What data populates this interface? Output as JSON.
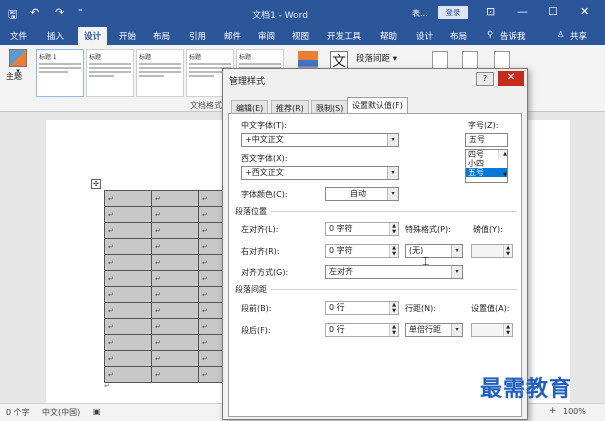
{
  "titlebar": {
    "doc_title": "文档1 - Word",
    "account": "表...",
    "login": "登录",
    "save_glyph": "🖫",
    "undo_glyph": "↶",
    "redo_glyph": "↷",
    "customize_glyph": "⁼",
    "ribbon_display_glyph": "⊡",
    "minimize_glyph": "—",
    "maximize_glyph": "☐",
    "close_glyph": "✕"
  },
  "tabs": [
    "文件",
    "插入",
    "设计",
    "开始",
    "布局",
    "引用",
    "邮件",
    "审阅",
    "视图",
    "开发工具",
    "帮助",
    "设计",
    "布局"
  ],
  "active_tab_index": 2,
  "tell_me": "告诉我",
  "share": "共享",
  "ribbon": {
    "theme_label": "主题",
    "theme_dropdown": "▾",
    "gallery": [
      {
        "title": "标题 1"
      },
      {
        "title": "标题"
      },
      {
        "title": "标题"
      },
      {
        "title": "标题"
      },
      {
        "title": "标题"
      }
    ],
    "group_label": "文档格式",
    "fonts_glyph": "文",
    "paragraph_spacing": "段落间距",
    "paragraph_spacing_arrow": "▾"
  },
  "dialog": {
    "title": "管理样式",
    "help": "?",
    "close": "✕",
    "tabs": [
      "编辑(E)",
      "推荐(R)",
      "限制(S)",
      "设置默认值(F)"
    ],
    "active_tab_index": 3,
    "chinese_font_label": "中文字体(T):",
    "chinese_font_value": "+中文正文",
    "western_font_label": "西文字体(X):",
    "western_font_value": "+西文正文",
    "font_size_label": "字号(Z):",
    "font_size_value": "五号",
    "font_size_options": [
      "四号",
      "小四",
      "五号"
    ],
    "font_size_selected_index": 2,
    "font_color_label": "字体颜色(C):",
    "font_color_value": "自动",
    "para_position_section": "段落位置",
    "left_indent_label": "左对齐(L):",
    "left_indent_value": "0 字符",
    "special_format_label": "特殊格式(P):",
    "special_format_value": "(无)",
    "indent_amount_label": "磅值(Y):",
    "right_indent_label": "右对齐(R):",
    "right_indent_value": "0 字符",
    "alignment_label": "对齐方式(G):",
    "alignment_value": "左对齐",
    "para_spacing_section": "段落间距",
    "before_label": "段前(B):",
    "before_value": "0 行",
    "line_spacing_label": "行距(N):",
    "line_spacing_value": "单倍行距",
    "setting_label": "设置值(A):",
    "after_label": "段后(F):",
    "after_value": "0 行",
    "dropdown_arrow": "▾",
    "spin_up": "▲",
    "spin_down": "▼"
  },
  "document": {
    "table_rows": 12,
    "table_cols": 3,
    "cell_mark": "↵",
    "anchor_glyph": "✣"
  },
  "status": {
    "word_count": "0 个字",
    "language": "中文(中国)",
    "zoom": "100%",
    "zoom_plus": "+"
  },
  "watermark_text": "最需教育",
  "colors": {
    "titlebar": "#2b579a",
    "close_button": "#c42b1c",
    "selection": "#0078d7",
    "watermark": "#1f5fbf"
  }
}
